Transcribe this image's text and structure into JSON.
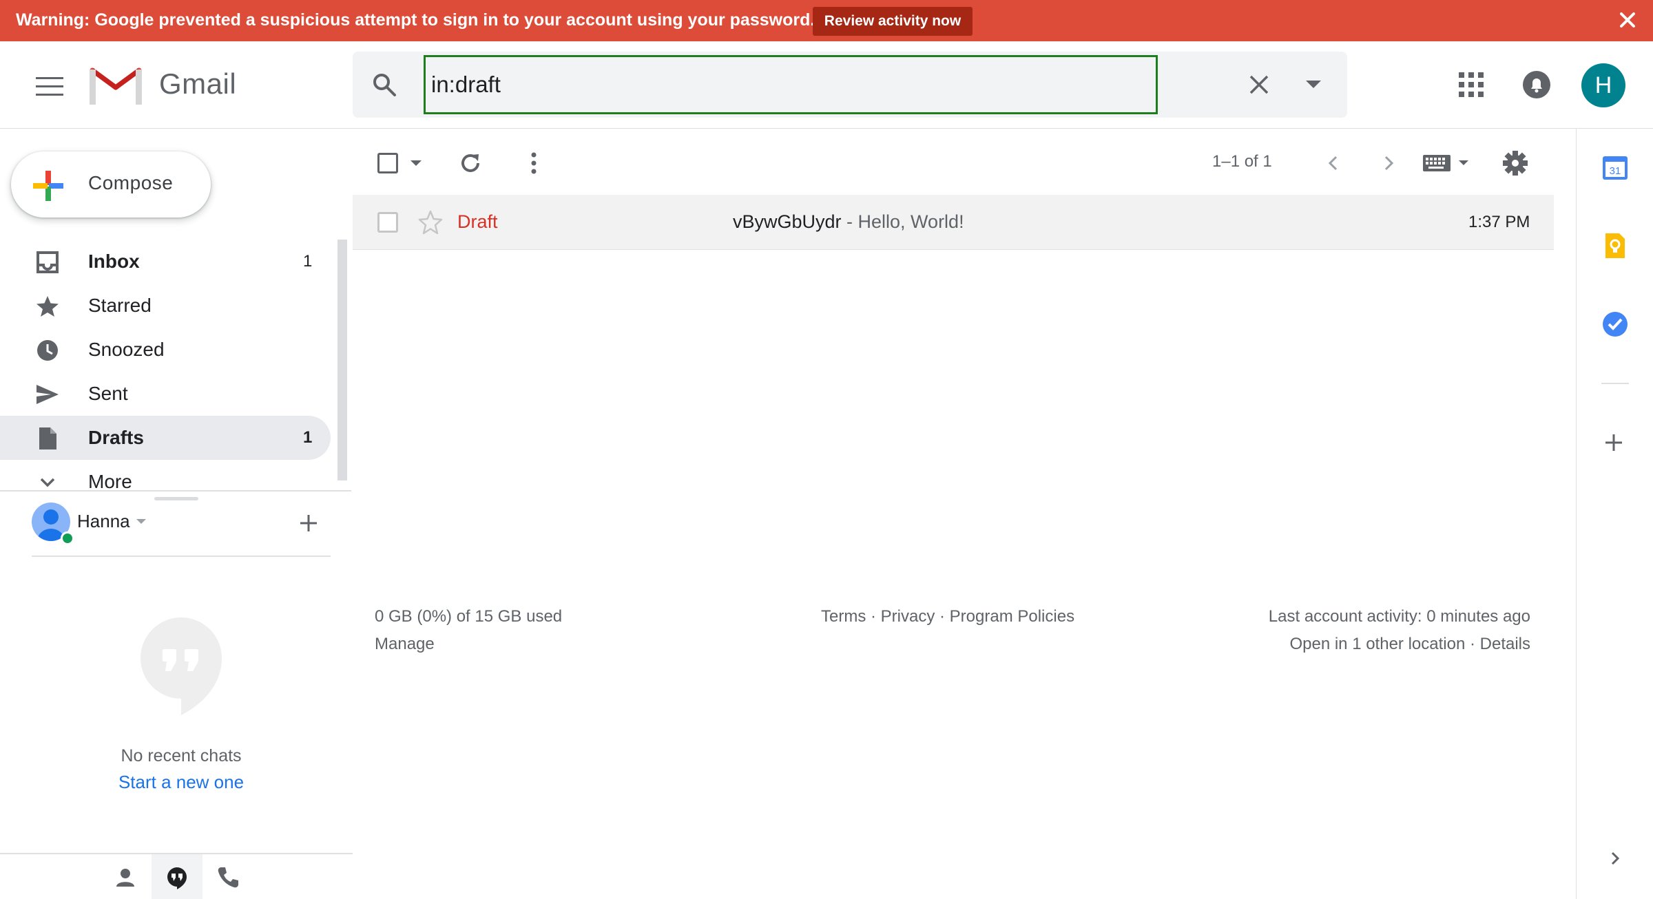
{
  "banner": {
    "text": "Warning: Google prevented a suspicious attempt to sign in to your account using your password.",
    "button_label": "Review activity now",
    "color": "#dd4b39"
  },
  "header": {
    "logo_text": "Gmail",
    "search_value": "in:draft",
    "avatar_letter": "H",
    "avatar_color": "#00838f"
  },
  "compose": {
    "label": "Compose"
  },
  "nav": {
    "items": [
      {
        "label": "Inbox",
        "count": "1",
        "icon": "inbox-icon",
        "bold": true
      },
      {
        "label": "Starred",
        "count": "",
        "icon": "star-icon",
        "bold": false
      },
      {
        "label": "Snoozed",
        "count": "",
        "icon": "clock-icon",
        "bold": false
      },
      {
        "label": "Sent",
        "count": "",
        "icon": "send-icon",
        "bold": false
      },
      {
        "label": "Drafts",
        "count": "1",
        "icon": "draft-icon",
        "bold": true,
        "active": true
      },
      {
        "label": "More",
        "count": "",
        "icon": "chevron-down-icon",
        "bold": false
      }
    ]
  },
  "hangouts": {
    "user_name": "Hanna",
    "no_chats": "No recent chats",
    "start_new": "Start a new one"
  },
  "toolbar": {
    "range": "1–1 of 1"
  },
  "messages": [
    {
      "sender": "Draft",
      "subject": "vBywGbUydr",
      "snippet": " - Hello, World!",
      "time": "1:37 PM"
    }
  ],
  "footer": {
    "storage": "0 GB (0%) of 15 GB used",
    "manage": "Manage",
    "links": "Terms · Privacy · Program Policies",
    "activity": "Last account activity: 0 minutes ago",
    "location": "Open in 1 other location · Details"
  },
  "side_panel": {
    "calendar_day": "31"
  }
}
